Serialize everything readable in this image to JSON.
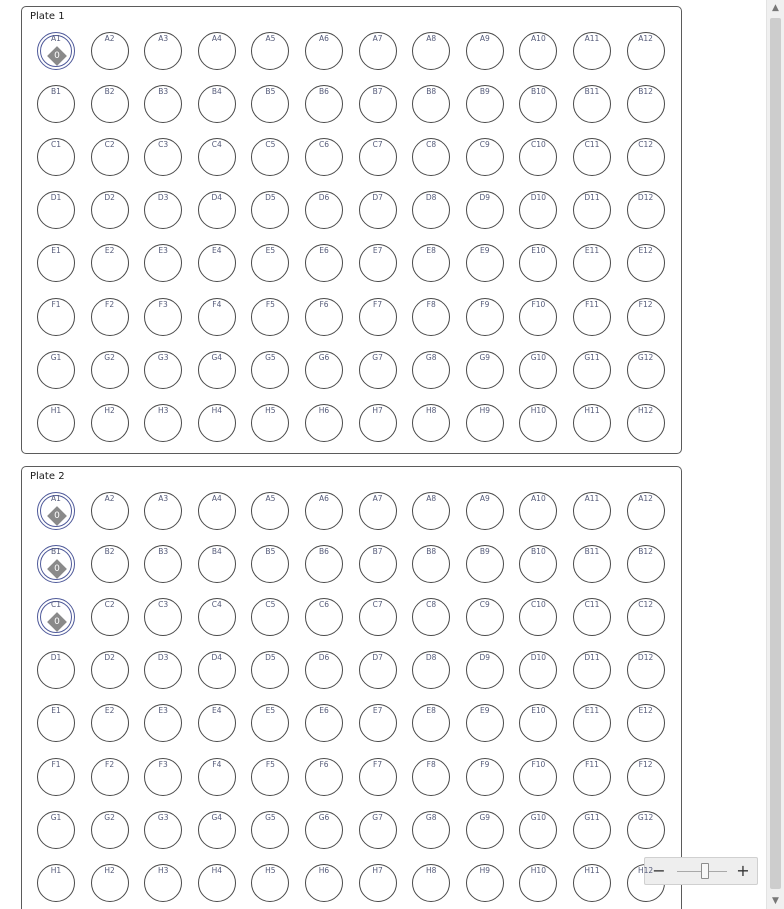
{
  "plates": [
    {
      "title": "Plate  1",
      "rows": [
        "A",
        "B",
        "C",
        "D",
        "E",
        "F",
        "G",
        "H"
      ],
      "columns": 12,
      "marked_wells": [
        {
          "well": "A1",
          "count": "0"
        }
      ]
    },
    {
      "title": "Plate  2",
      "rows": [
        "A",
        "B",
        "C",
        "D",
        "E",
        "F",
        "G",
        "H"
      ],
      "columns": 12,
      "marked_wells": [
        {
          "well": "A1",
          "count": "0"
        },
        {
          "well": "B1",
          "count": "0"
        },
        {
          "well": "C1",
          "count": "0"
        }
      ]
    }
  ],
  "zoom": {
    "minus_label": "−",
    "plus_label": "+",
    "level": 0.55
  },
  "scrollbar": {
    "up_arrow": "▲",
    "down_arrow": "▼"
  },
  "colors": {
    "well_border": "#4a4a4a",
    "selected_ring": "#4f5a9a",
    "marker": "#8a8a8a",
    "label": "#555b7a"
  }
}
